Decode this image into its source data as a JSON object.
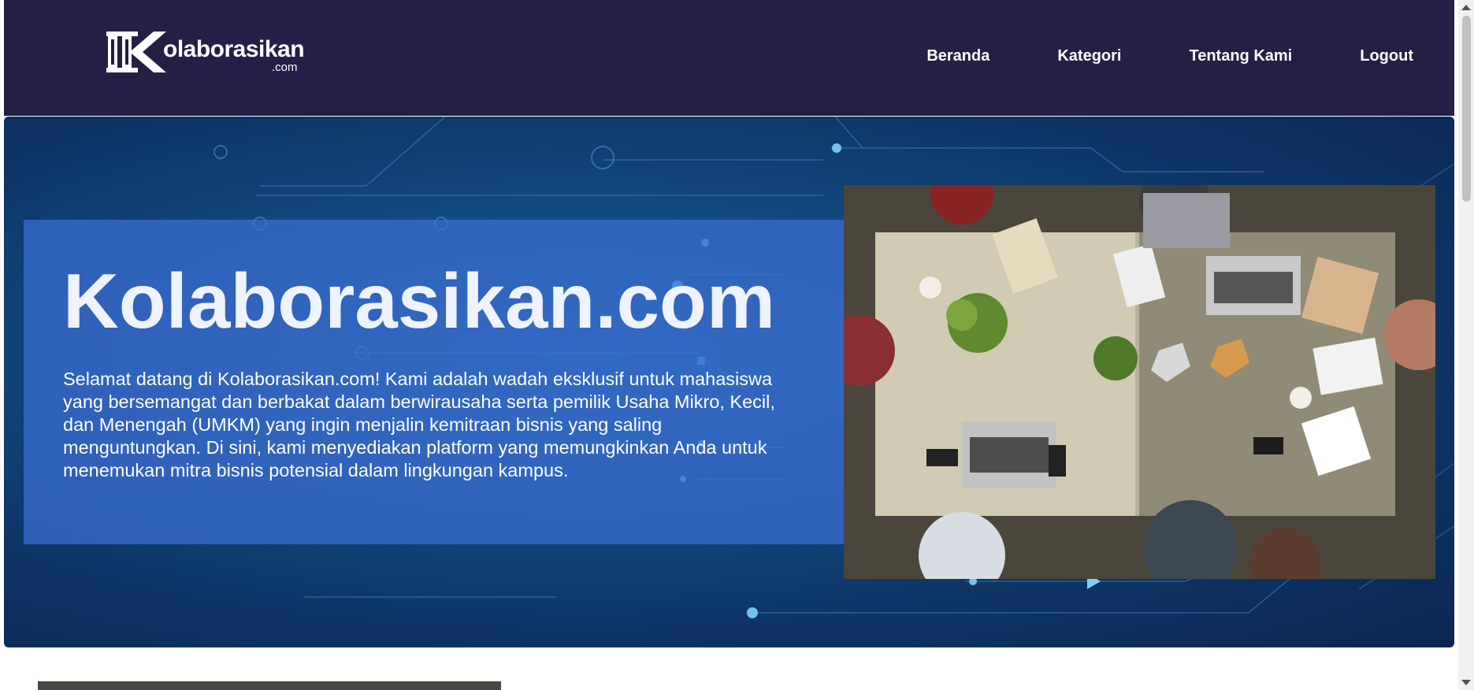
{
  "header": {
    "logo_text": "olaborasikan",
    "logo_sub": ".com",
    "nav": [
      {
        "label": "Beranda"
      },
      {
        "label": "Kategori"
      },
      {
        "label": "Tentang Kami"
      },
      {
        "label": "Logout"
      }
    ]
  },
  "hero": {
    "title": "Kolaborasikan.com",
    "description": "Selamat datang di Kolaborasikan.com! Kami adalah wadah eksklusif untuk mahasiswa yang bersemangat dan berbakat dalam berwirausaha serta pemilik Usaha Mikro, Kecil, dan Menengah (UMKM) yang ingin menjalin kemitraan bisnis yang saling menguntungkan. Di sini, kami menyediakan platform yang memungkinkan Anda untuk menemukan mitra bisnis potensial dalam lingkungan kampus."
  },
  "colors": {
    "navbar_bg": "#241f45",
    "hero_bg": "#134a80",
    "hero_box": "#3c6ed2"
  },
  "icons": {
    "logo": "kolaborasikan-logo-mark"
  }
}
